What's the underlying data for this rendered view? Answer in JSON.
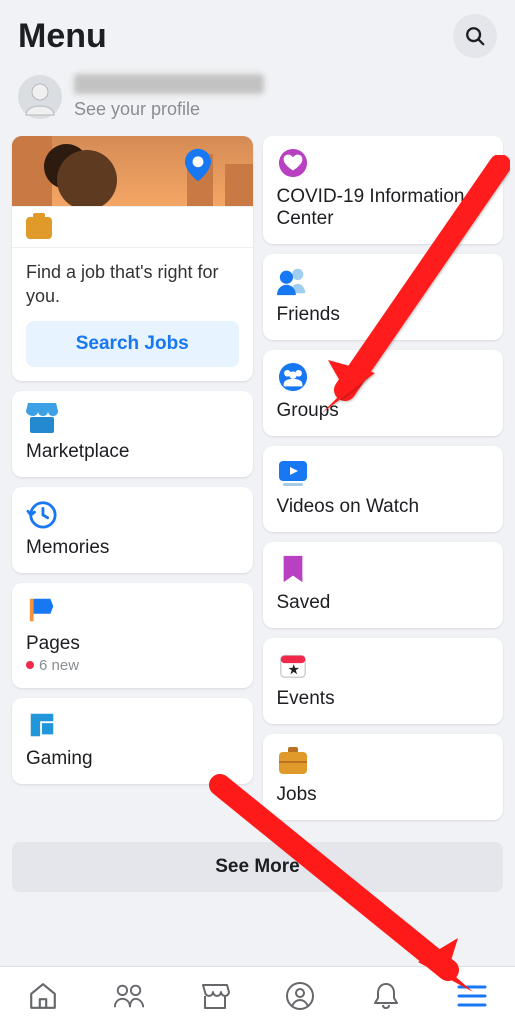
{
  "header": {
    "title": "Menu"
  },
  "profile": {
    "subtitle": "See your profile"
  },
  "jobs_card": {
    "promo_text": "Find a job that's right for you.",
    "button_label": "Search Jobs"
  },
  "left_tiles": {
    "marketplace": "Marketplace",
    "memories": "Memories",
    "pages": "Pages",
    "pages_sub": "6 new",
    "gaming": "Gaming"
  },
  "right_tiles": {
    "covid": "COVID-19 Information Center",
    "friends": "Friends",
    "groups": "Groups",
    "videos": "Videos on Watch",
    "saved": "Saved",
    "events": "Events",
    "jobs": "Jobs"
  },
  "see_more": "See More"
}
